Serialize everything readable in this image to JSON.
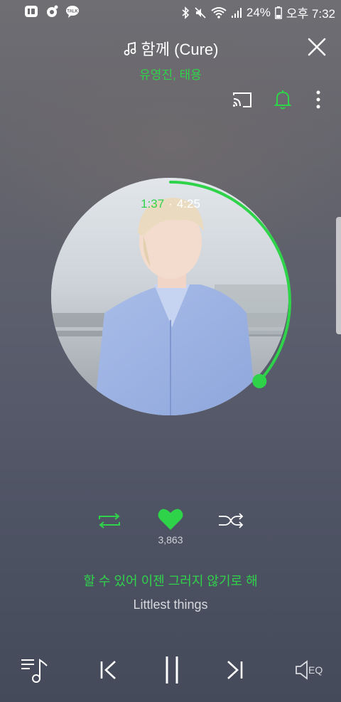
{
  "status_bar": {
    "battery": "24%",
    "time": "오후 7:32",
    "kakao_badge": "TALK"
  },
  "header": {
    "title": "함께 (Cure)",
    "artist": "유영진, 태용"
  },
  "player": {
    "elapsed": "1:37",
    "total": "4:25",
    "progress": 0.366,
    "like_count": "3,863"
  },
  "lyrics": {
    "current": "할 수 있어 이젠 그러지 않기로 해",
    "next": "Littlest things"
  },
  "bottom_bar": {
    "eq_label": "EQ"
  },
  "colors": {
    "accent": "#2fd34a",
    "text": "#ffffff",
    "muted": "#d7d9de"
  }
}
